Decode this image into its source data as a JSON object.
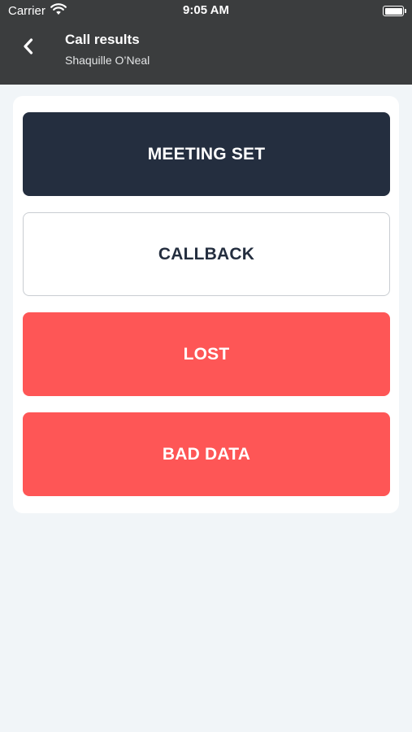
{
  "status_bar": {
    "carrier": "Carrier",
    "time": "9:05 AM",
    "wifi_icon": "wifi-icon",
    "battery_icon": "battery-icon",
    "battery_level": 1.0
  },
  "header": {
    "back_icon": "chevron-left-icon",
    "title": "Call results",
    "subtitle": "Shaquille O’Neal"
  },
  "results": {
    "meeting_set": "MEETING SET",
    "callback": "CALLBACK",
    "lost": "LOST",
    "bad_data": "BAD DATA"
  },
  "colors": {
    "header_bg": "#3b3d3e",
    "page_bg": "#f1f5f8",
    "primary_dark": "#242e3f",
    "danger": "#fe5656",
    "white": "#ffffff"
  }
}
